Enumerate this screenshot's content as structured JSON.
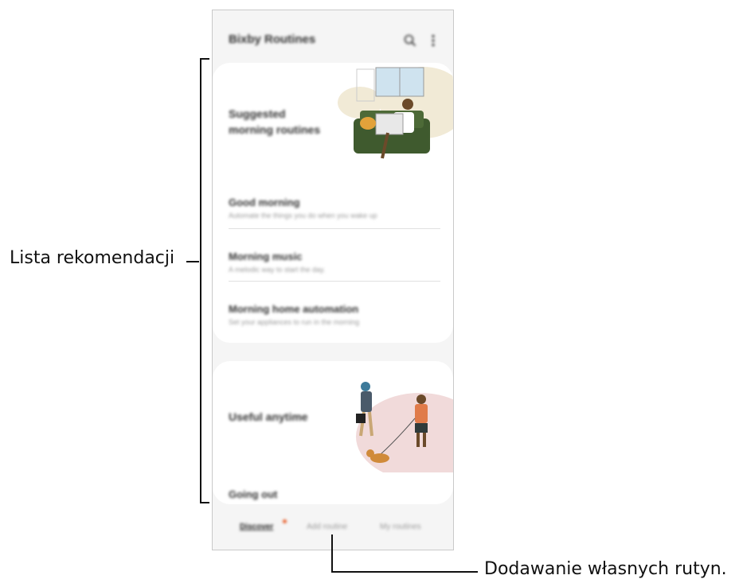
{
  "app": {
    "title": "Bixby Routines"
  },
  "icons": {
    "search": "search-icon",
    "more": "more-vertical-icon"
  },
  "card1": {
    "title": "Suggested\nmorning routines",
    "items": [
      {
        "title": "Good morning",
        "desc": "Automate the things you do when you wake up"
      },
      {
        "title": "Morning music",
        "desc": "A melodic way to start the day."
      },
      {
        "title": "Morning home automation",
        "desc": "Set your appliances to run in the morning"
      }
    ]
  },
  "card2": {
    "title": "Useful anytime",
    "item": "Going out"
  },
  "nav": {
    "tabs": [
      "Discover",
      "Add routine",
      "My routines"
    ],
    "active_index": 0,
    "badge_color": "#e8602c"
  },
  "annotations": {
    "left": "Lista rekomendacji",
    "bottom": "Dodawanie własnych rutyn."
  }
}
